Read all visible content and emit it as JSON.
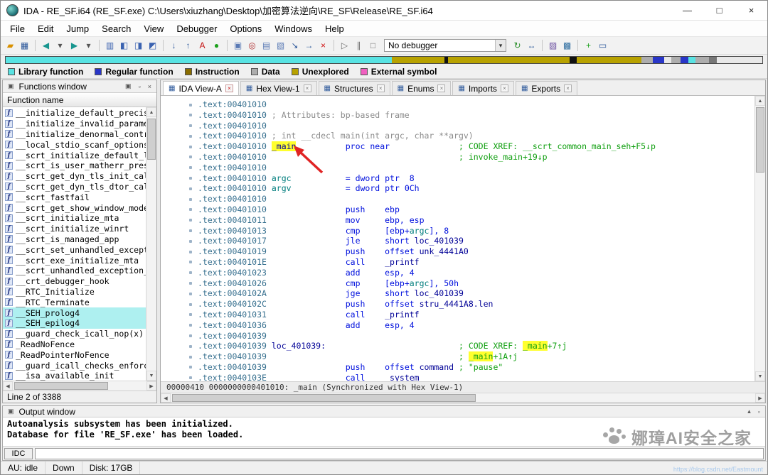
{
  "window": {
    "title": "IDA - RE_SF.i64 (RE_SF.exe) C:\\Users\\xiuzhang\\Desktop\\加密算法逆向\\RE_SF\\Release\\RE_SF.i64"
  },
  "icons": {
    "minimize": "—",
    "maximize": "□",
    "close": "×",
    "restore": "▣",
    "float": "▫",
    "dock": "▴",
    "chevron_down": "▾",
    "up": "▲",
    "down": "▼",
    "left": "◀",
    "right": "▶",
    "tab_view": "▦"
  },
  "menu": {
    "items": [
      "File",
      "Edit",
      "Jump",
      "Search",
      "View",
      "Debugger",
      "Options",
      "Windows",
      "Help"
    ]
  },
  "toolbar": {
    "debugger": "No debugger",
    "items": [
      {
        "name": "open-file-icon",
        "glyph": "▰",
        "color": "#d99000"
      },
      {
        "name": "save-icon",
        "glyph": "▦",
        "color": "#2b579a"
      },
      {
        "type": "sep"
      },
      {
        "name": "nav-back-icon",
        "glyph": "◀",
        "color": "#18968f"
      },
      {
        "name": "nav-back-dropdown-icon",
        "glyph": "▾",
        "color": "#555555"
      },
      {
        "name": "nav-forward-icon",
        "glyph": "▶",
        "color": "#18968f"
      },
      {
        "name": "nav-forward-dropdown-icon",
        "glyph": "▾",
        "color": "#555555"
      },
      {
        "type": "sep"
      },
      {
        "name": "jump-by-name-icon",
        "glyph": "▥",
        "color": "#3a62b0"
      },
      {
        "name": "jump-to-address-icon",
        "glyph": "◧",
        "color": "#3a62b0"
      },
      {
        "name": "jump-to-segment-icon",
        "glyph": "◨",
        "color": "#3a62b0"
      },
      {
        "name": "jump-to-xref-icon",
        "glyph": "◩",
        "color": "#3a62b0"
      },
      {
        "type": "sep"
      },
      {
        "name": "jump-next-icon",
        "glyph": "↓",
        "color": "#2b579a"
      },
      {
        "name": "jump-prev-icon",
        "glyph": "↑",
        "color": "#2b579a"
      },
      {
        "name": "strings-window-icon",
        "glyph": "A",
        "color": "#c41212"
      },
      {
        "name": "run-autoanalysis-icon",
        "glyph": "●",
        "color": "#1ca01c"
      },
      {
        "type": "sep"
      },
      {
        "name": "debugger-windows-icon",
        "glyph": "▣",
        "color": "#5a7ab5"
      },
      {
        "name": "breakpoints-icon",
        "glyph": "◎",
        "color": "#b03030"
      },
      {
        "name": "call-stack-icon",
        "glyph": "▤",
        "color": "#5a7ab5"
      },
      {
        "name": "watches-icon",
        "glyph": "▧",
        "color": "#5a7ab5"
      },
      {
        "name": "step-into-icon",
        "glyph": "↘",
        "color": "#2b579a"
      },
      {
        "name": "step-over-icon",
        "glyph": "→",
        "color": "#2b579a"
      },
      {
        "name": "cancel-icon",
        "glyph": "×",
        "color": "#d01010"
      },
      {
        "type": "sep"
      },
      {
        "name": "start-process-icon",
        "glyph": "▷",
        "color": "#707070"
      },
      {
        "name": "pause-process-icon",
        "glyph": "∥",
        "color": "#707070"
      },
      {
        "name": "stop-process-icon",
        "glyph": "□",
        "color": "#707070"
      },
      {
        "type": "combo"
      },
      {
        "name": "refresh-icon",
        "glyph": "↻",
        "color": "#2b8f2b"
      },
      {
        "name": "attach-icon",
        "glyph": "↔",
        "color": "#2b579a"
      },
      {
        "type": "sep"
      },
      {
        "name": "script-command-icon",
        "glyph": "▨",
        "color": "#6a4ea0"
      },
      {
        "name": "python-console-icon",
        "glyph": "▩",
        "color": "#2e6da0"
      },
      {
        "type": "sep"
      },
      {
        "name": "add-breakpoint-icon",
        "glyph": "+",
        "color": "#1ca01c"
      },
      {
        "name": "segments-icon",
        "glyph": "▭",
        "color": "#2b579a"
      }
    ]
  },
  "nav_band": {
    "segments": [
      {
        "c": "#59e3e3",
        "w": 51
      },
      {
        "c": "#b8a200",
        "w": 7
      },
      {
        "c": "#111111",
        "w": 0.5
      },
      {
        "c": "#b8a200",
        "w": 16
      },
      {
        "c": "#111111",
        "w": 1
      },
      {
        "c": "#b8a200",
        "w": 8.5
      },
      {
        "c": "#adadad",
        "w": 1.5
      },
      {
        "c": "#2936c8",
        "w": 1.5
      },
      {
        "c": "#e8e8e8",
        "w": 1
      },
      {
        "c": "#adadad",
        "w": 1.2
      },
      {
        "c": "#2936c8",
        "w": 1
      },
      {
        "c": "#59e3e3",
        "w": 1
      },
      {
        "c": "#adadad",
        "w": 1.8
      },
      {
        "c": "#777777",
        "w": 1
      },
      {
        "c": "#e8e8e8",
        "w": 6
      }
    ]
  },
  "legend": {
    "items": [
      {
        "label": "Library function",
        "color": "#59e3e3"
      },
      {
        "label": "Regular function",
        "color": "#2936c8"
      },
      {
        "label": "Instruction",
        "color": "#8a6d00"
      },
      {
        "label": "Data",
        "color": "#adadad"
      },
      {
        "label": "Unexplored",
        "color": "#b8a200"
      },
      {
        "label": "External symbol",
        "color": "#f060c0"
      }
    ]
  },
  "functions_panel": {
    "title": "Functions window",
    "column_header": "Function name",
    "status": "Line 2 of 3388",
    "rows": [
      {
        "label": "__initialize_default_precisi"
      },
      {
        "label": "__initialize_invalid_paramet"
      },
      {
        "label": "__initialize_denormal_contro"
      },
      {
        "label": "__local_stdio_scanf_options"
      },
      {
        "label": "__scrt_initialize_default_l"
      },
      {
        "label": "__scrt_is_user_matherr_pres"
      },
      {
        "label": "__scrt_get_dyn_tls_init_cal"
      },
      {
        "label": "__scrt_get_dyn_tls_dtor_cal"
      },
      {
        "label": "__scrt_fastfail"
      },
      {
        "label": "__scrt_get_show_window_mode"
      },
      {
        "label": "__scrt_initialize_mta"
      },
      {
        "label": "__scrt_initialize_winrt"
      },
      {
        "label": "__scrt_is_managed_app"
      },
      {
        "label": "__scrt_set_unhandled_except"
      },
      {
        "label": "__scrt_exe_initialize_mta"
      },
      {
        "label": "__scrt_unhandled_exception_f"
      },
      {
        "label": "__crt_debugger_hook"
      },
      {
        "label": "__RTC_Initialize"
      },
      {
        "label": "__RTC_Terminate"
      },
      {
        "label": "__SEH_prolog4",
        "hl": true
      },
      {
        "label": "__SEH_epilog4",
        "hl": true
      },
      {
        "label": "__guard_check_icall_nop(x)"
      },
      {
        "label": "_ReadNoFence"
      },
      {
        "label": "_ReadPointerNoFence"
      },
      {
        "label": "__guard_icall_checks_enforce"
      },
      {
        "label": "__isa_available_init"
      }
    ]
  },
  "tabs": [
    {
      "label": "IDA View-A",
      "active": true
    },
    {
      "label": "Hex View-1"
    },
    {
      "label": "Structures"
    },
    {
      "label": "Enums"
    },
    {
      "label": "Imports"
    },
    {
      "label": "Exports"
    }
  ],
  "disassembly": {
    "sync_line": "00000410 0000000000401010: _main (Synchronized with Hex View-1)",
    "lines": [
      {
        "a": ".text:00401010",
        "s": []
      },
      {
        "a": ".text:00401010",
        "s": [
          [
            "g",
            "; Attributes: bp-based frame"
          ]
        ]
      },
      {
        "a": ".text:00401010",
        "s": []
      },
      {
        "a": ".text:00401010",
        "s": [
          [
            "g",
            "; int __cdecl main(int argc, char **argv)"
          ]
        ]
      },
      {
        "a": ".text:00401010",
        "s": [
          [
            "h",
            "_main"
          ],
          [
            "p",
            10
          ],
          [
            "k",
            "proc near"
          ],
          [
            "p",
            14
          ],
          [
            "x",
            "; CODE XREF: __scrt_common_main_seh+F5↓p"
          ]
        ]
      },
      {
        "a": ".text:00401010",
        "s": [
          [
            "p",
            38
          ],
          [
            "x",
            "; invoke_main+19↓p"
          ]
        ]
      },
      {
        "a": ".text:00401010",
        "s": []
      },
      {
        "a": ".text:00401010",
        "s": [
          [
            "v",
            "argc"
          ],
          [
            "p",
            11
          ],
          [
            "k",
            "= dword ptr  8"
          ]
        ]
      },
      {
        "a": ".text:00401010",
        "s": [
          [
            "v",
            "argv"
          ],
          [
            "p",
            11
          ],
          [
            "k",
            "= dword ptr 0Ch"
          ]
        ]
      },
      {
        "a": ".text:00401010",
        "s": []
      },
      {
        "a": ".text:00401010",
        "s": [
          [
            "p",
            15
          ],
          [
            "m",
            "push"
          ],
          [
            "p",
            4
          ],
          [
            "o",
            "ebp"
          ]
        ]
      },
      {
        "a": ".text:00401011",
        "s": [
          [
            "p",
            15
          ],
          [
            "m",
            "mov"
          ],
          [
            "p",
            5
          ],
          [
            "o",
            "ebp, esp"
          ]
        ]
      },
      {
        "a": ".text:00401013",
        "s": [
          [
            "p",
            15
          ],
          [
            "m",
            "cmp"
          ],
          [
            "p",
            5
          ],
          [
            "o",
            "[ebp+"
          ],
          [
            "v",
            "argc"
          ],
          [
            "o",
            "], 8"
          ]
        ]
      },
      {
        "a": ".text:00401017",
        "s": [
          [
            "p",
            15
          ],
          [
            "m",
            "jle"
          ],
          [
            "p",
            5
          ],
          [
            "k",
            "short "
          ],
          [
            "n",
            "loc_401039"
          ]
        ]
      },
      {
        "a": ".text:00401019",
        "s": [
          [
            "p",
            15
          ],
          [
            "m",
            "push"
          ],
          [
            "p",
            4
          ],
          [
            "k",
            "offset "
          ],
          [
            "n",
            "unk_4441A0"
          ]
        ]
      },
      {
        "a": ".text:0040101E",
        "s": [
          [
            "p",
            15
          ],
          [
            "m",
            "call"
          ],
          [
            "p",
            4
          ],
          [
            "n",
            "_printf"
          ]
        ]
      },
      {
        "a": ".text:00401023",
        "s": [
          [
            "p",
            15
          ],
          [
            "m",
            "add"
          ],
          [
            "p",
            5
          ],
          [
            "o",
            "esp, 4"
          ]
        ]
      },
      {
        "a": ".text:00401026",
        "s": [
          [
            "p",
            15
          ],
          [
            "m",
            "cmp"
          ],
          [
            "p",
            5
          ],
          [
            "o",
            "[ebp+"
          ],
          [
            "v",
            "argc"
          ],
          [
            "o",
            "], 50h"
          ]
        ]
      },
      {
        "a": ".text:0040102A",
        "s": [
          [
            "p",
            15
          ],
          [
            "m",
            "jge"
          ],
          [
            "p",
            5
          ],
          [
            "k",
            "short "
          ],
          [
            "n",
            "loc_401039"
          ]
        ]
      },
      {
        "a": ".text:0040102C",
        "s": [
          [
            "p",
            15
          ],
          [
            "m",
            "push"
          ],
          [
            "p",
            4
          ],
          [
            "k",
            "offset "
          ],
          [
            "n",
            "stru_4441A8.len"
          ]
        ]
      },
      {
        "a": ".text:00401031",
        "s": [
          [
            "p",
            15
          ],
          [
            "m",
            "call"
          ],
          [
            "p",
            4
          ],
          [
            "n",
            "_printf"
          ]
        ]
      },
      {
        "a": ".text:00401036",
        "s": [
          [
            "p",
            15
          ],
          [
            "m",
            "add"
          ],
          [
            "p",
            5
          ],
          [
            "o",
            "esp, 4"
          ]
        ]
      },
      {
        "a": ".text:00401039",
        "s": []
      },
      {
        "a": ".text:00401039",
        "s": [
          [
            "n",
            "loc_401039:"
          ],
          [
            "p",
            27
          ],
          [
            "x",
            "; CODE XREF: "
          ],
          [
            "H",
            "_main"
          ],
          [
            "x",
            "+7↑j"
          ]
        ]
      },
      {
        "a": ".text:00401039",
        "s": [
          [
            "p",
            38
          ],
          [
            "x",
            "; "
          ],
          [
            "H",
            "_main"
          ],
          [
            "x",
            "+1A↑j"
          ]
        ]
      },
      {
        "a": ".text:00401039",
        "s": [
          [
            "p",
            15
          ],
          [
            "m",
            "push"
          ],
          [
            "p",
            4
          ],
          [
            "k",
            "offset "
          ],
          [
            "n",
            "command"
          ],
          [
            "p",
            1
          ],
          [
            "s",
            "; \"pause\""
          ]
        ]
      },
      {
        "a": ".text:0040103E",
        "s": [
          [
            "p",
            15
          ],
          [
            "m",
            "call"
          ],
          [
            "p",
            4
          ],
          [
            "n",
            "_system"
          ]
        ]
      }
    ]
  },
  "output": {
    "title": "Output window",
    "prompt": "IDC",
    "lines": [
      "Autoanalysis subsystem has been initialized.",
      "Database for file 'RE_SF.exe' has been loaded."
    ]
  },
  "status_bar": {
    "au": "AU: idle",
    "down": "Down",
    "disk": "Disk: 17GB"
  },
  "watermark": {
    "text": "娜璋AI安全之家",
    "url": "https://blog.csdn.net/Eastmount"
  }
}
